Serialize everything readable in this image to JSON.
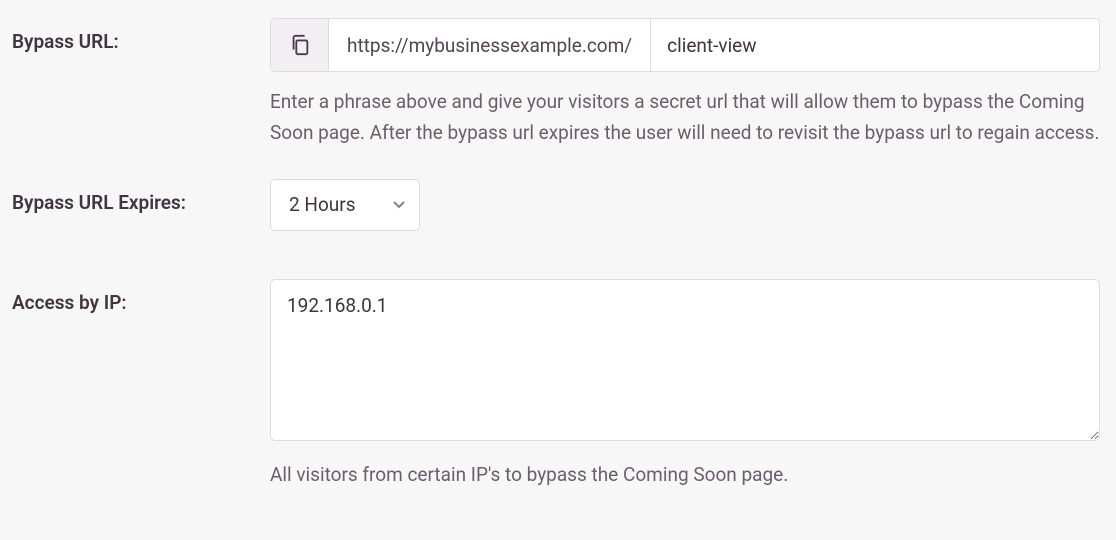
{
  "bypass_url": {
    "label": "Bypass URL:",
    "prefix": "https://mybusinessexample.com/",
    "value": "client-view",
    "help": "Enter a phrase above and give your visitors a secret url that will allow them to bypass the Coming Soon page. After the bypass url expires the user will need to revisit the bypass url to regain access."
  },
  "bypass_expires": {
    "label": "Bypass URL Expires:",
    "value": "2 Hours"
  },
  "access_ip": {
    "label": "Access by IP:",
    "value": "192.168.0.1",
    "help": "All visitors from certain IP's to bypass the Coming Soon page."
  }
}
